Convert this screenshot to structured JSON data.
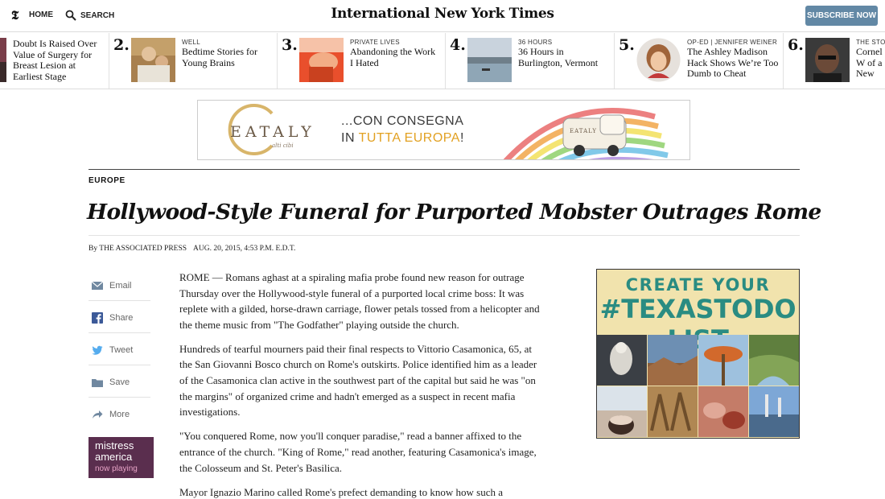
{
  "topbar": {
    "logo": "𝕿",
    "home_label": "HOME",
    "search_label": "SEARCH",
    "masthead": "International New York Times",
    "subscribe_label": "SUBSCRIBE NOW"
  },
  "most_popular": [
    {
      "num": "",
      "kicker": "",
      "headline": "Doubt Is Raised Over Value of Surgery for Breast Lesion at Earliest Stage"
    },
    {
      "num": "2.",
      "kicker": "WELL",
      "headline": "Bedtime Stories for Young Brains"
    },
    {
      "num": "3.",
      "kicker": "PRIVATE LIVES",
      "headline": "Abandoning the Work I Hated"
    },
    {
      "num": "4.",
      "kicker": "36 HOURS",
      "headline": "36 Hours in Burlington, Vermont"
    },
    {
      "num": "5.",
      "kicker": "OP-ED | JENNIFER WEINER",
      "headline": "The Ashley Madison Hack Shows We’re Too Dumb to Cheat"
    },
    {
      "num": "6.",
      "kicker": "THE STON",
      "headline": "Cornel W of a New"
    }
  ],
  "ad_banner": {
    "logo": "EATALY",
    "logo_sub": "alti cibi",
    "line1": "...CON CONSEGNA",
    "line2_prefix": "IN ",
    "line2_highlight": "TUTTA EUROPA",
    "line2_suffix": "!",
    "van_text": "EATALY"
  },
  "article": {
    "section": "EUROPE",
    "headline": "Hollywood-Style Funeral for Purported Mobster Outrages Rome",
    "byline": "By THE ASSOCIATED PRESS",
    "date": "AUG. 20, 2015, 4:53 P.M. E.D.T.",
    "paragraphs": [
      "ROME — Romans aghast at a spiraling mafia probe found new reason for outrage Thursday over the Hollywood-style funeral of a purported local crime boss: It was replete with a gilded, horse-drawn carriage, flower petals tossed from a helicopter and the theme music from \"The Godfather\" playing outside the church.",
      "Hundreds of tearful mourners paid their final respects to Vittorio Casamonica, 65, at the San Giovanni Bosco church on Rome's outskirts. Police identified him as a leader of the Casamonica clan active in the southwest part of the capital but said he was \"on the margins\" of organized crime and hadn't emerged as a suspect in recent mafia investigations.",
      "\"You conquered Rome, now you'll conquer paradise,\" read a banner affixed to the entrance of the church. \"King of Rome,\" read another, featuring Casamonica's image, the Colosseum and St. Peter's Basilica.",
      "Mayor Ignazio Marino called Rome's prefect demanding to know how such a"
    ]
  },
  "share_tools": [
    {
      "label": "Email",
      "icon": "email-icon"
    },
    {
      "label": "Share",
      "icon": "facebook-icon"
    },
    {
      "label": "Tweet",
      "icon": "twitter-icon"
    },
    {
      "label": "Save",
      "icon": "save-icon"
    },
    {
      "label": "More",
      "icon": "more-icon"
    }
  ],
  "promo": {
    "line1": "mistress",
    "line2": "america",
    "line3": "now playing"
  },
  "side_ad": {
    "line1": "CREATE YOUR",
    "line2": "#TEXASTODO LIST"
  },
  "colors": {
    "accent": "#6288a5",
    "ad_teal": "#2a8c82",
    "ad_cream": "#f1e3ad",
    "promo_bg": "#5a2e4e"
  }
}
